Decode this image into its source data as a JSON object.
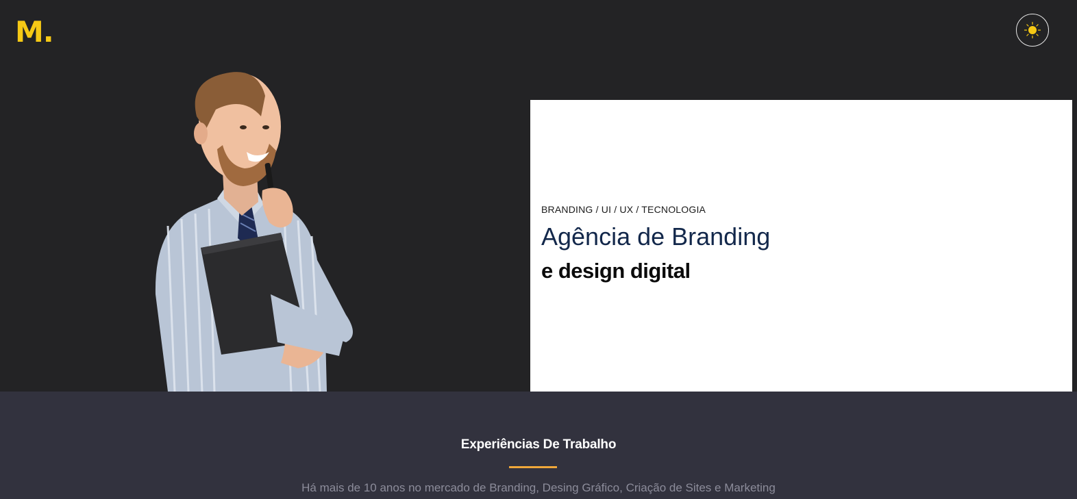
{
  "header": {
    "logo": "M.",
    "theme_toggle_icon": "sun-icon",
    "accent_color": "#f6c915"
  },
  "hero": {
    "image": "person-holding-folder-and-pen",
    "tags": "BRANDING / UI / UX / TECNOLOGIA",
    "title": "Agência de Branding",
    "subtitle": "e design digital"
  },
  "experience": {
    "title": "Experiências De Trabalho",
    "underline_color": "#f0a83a",
    "description": "Há mais de 10 anos no mercado de Branding, Desing Gráfico, Criação de Sites e Marketing"
  }
}
